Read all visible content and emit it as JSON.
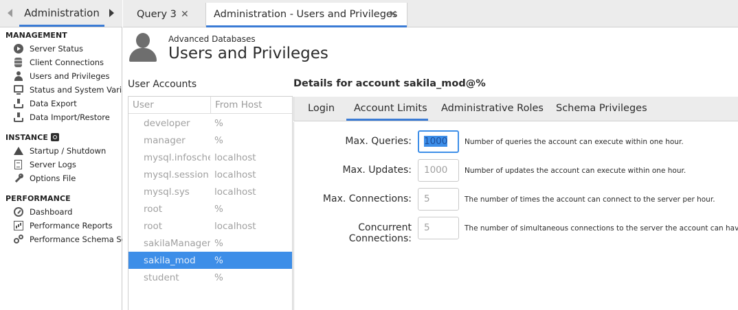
{
  "sidebar": {
    "tab_label": "Administration",
    "sections": {
      "management": "MANAGEMENT",
      "instance": "INSTANCE",
      "performance": "PERFORMANCE"
    },
    "items": {
      "server_status": "Server Status",
      "client_connections": "Client Connections",
      "users_privileges": "Users and Privileges",
      "status_vars": "Status and System Variab",
      "data_export": "Data Export",
      "data_import": "Data Import/Restore",
      "startup": "Startup / Shutdown",
      "server_logs": "Server Logs",
      "options_file": "Options File",
      "dashboard": "Dashboard",
      "perf_reports": "Performance Reports",
      "perf_schema": "Performance Schema Setu"
    }
  },
  "tabs": [
    {
      "label": "Query 3"
    },
    {
      "label": "Administration - Users and Privileges"
    }
  ],
  "header": {
    "subtitle": "Advanced Databases",
    "title": "Users and Privileges"
  },
  "accounts": {
    "label": "User Accounts",
    "col_user": "User",
    "col_host": "From Host",
    "rows": [
      {
        "user": "developer",
        "host": "%"
      },
      {
        "user": "manager",
        "host": "%"
      },
      {
        "user": "mysql.infoschema",
        "host": "localhost"
      },
      {
        "user": "mysql.session",
        "host": "localhost"
      },
      {
        "user": "mysql.sys",
        "host": "localhost"
      },
      {
        "user": "root",
        "host": "%"
      },
      {
        "user": "root",
        "host": "localhost"
      },
      {
        "user": "sakilaManager",
        "host": "%"
      },
      {
        "user": "sakila_mod",
        "host": "%"
      },
      {
        "user": "student",
        "host": "%"
      }
    ]
  },
  "details": {
    "title": "Details for account sakila_mod@%",
    "tabs": [
      "Login",
      "Account Limits",
      "Administrative Roles",
      "Schema Privileges"
    ],
    "limits": {
      "max_queries": {
        "label": "Max. Queries:",
        "value": "1000",
        "desc": "Number of queries the account can execute within one hour."
      },
      "max_updates": {
        "label": "Max. Updates:",
        "value": "1000",
        "desc": "Number of updates the account can execute within one hour."
      },
      "max_connections": {
        "label": "Max. Connections:",
        "value": "5",
        "desc": "The number of times the account can connect to the server per hour."
      },
      "concurrent": {
        "label": "Concurrent Connections:",
        "value": "5",
        "desc": "The number of simultaneous connections to the server the account can have."
      }
    }
  }
}
